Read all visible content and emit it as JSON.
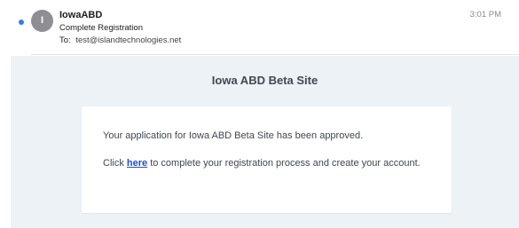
{
  "message": {
    "sender": "IowaABD",
    "avatar_initial": "I",
    "subject": "Complete Registration",
    "to_label": "To:",
    "to_address": "test@islandtechnologies.net",
    "time": "3:01 PM",
    "unread": true
  },
  "email_body": {
    "site_title": "Iowa ABD Beta Site",
    "paragraph_1": "Your application for Iowa ABD Beta Site has been approved.",
    "paragraph_2_prefix": "Click ",
    "link_text": "here",
    "paragraph_2_suffix": " to complete your registration process and create your account."
  },
  "colors": {
    "unread_dot": "#2f7cf6",
    "body_background": "#edf2f7",
    "link": "#1a4fd6",
    "text": "#3d4852"
  }
}
